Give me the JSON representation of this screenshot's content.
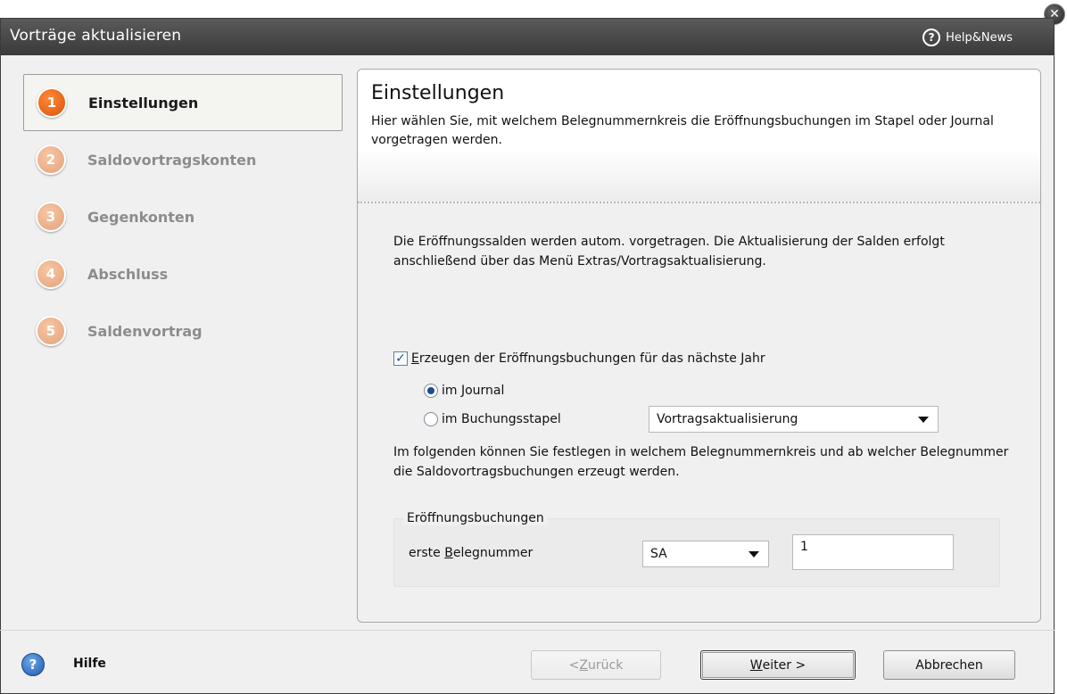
{
  "window": {
    "title": "Vorträge aktualisieren",
    "help_news": "Help&News"
  },
  "steps": [
    {
      "number": "1",
      "label": "Einstellungen",
      "active": true
    },
    {
      "number": "2",
      "label": "Saldovortragskonten",
      "active": false
    },
    {
      "number": "3",
      "label": "Gegenkonten",
      "active": false
    },
    {
      "number": "4",
      "label": "Abschluss",
      "active": false
    },
    {
      "number": "5",
      "label": "Saldenvortrag",
      "active": false
    }
  ],
  "header": {
    "title": "Einstellungen",
    "description": "Hier wählen Sie, mit welchem Belegnummernkreis die Eröffnungsbuchungen im Stapel oder Journal vorgetragen werden."
  },
  "body": {
    "info_text": "Die Eröffnungssalden werden autom. vorgetragen. Die Aktualisierung der Salden erfolgt anschließend über das Menü Extras/Vortragsaktualisierung.",
    "checkbox_label_u": "E",
    "checkbox_label_rest": "rzeugen der Eröffnungsbuchungen für das nächste Jahr",
    "radio_journal": "im Journal",
    "radio_stapel": "im Buchungsstapel",
    "stapel_select_value": "Vortragsaktualisierung",
    "belegnummer_text": "Im folgenden können Sie festlegen in welchem Belegnummernkreis und ab welcher Belegnummer die Saldovortragsbuchungen erzeugt werden."
  },
  "group": {
    "legend": "Eröffnungsbuchungen",
    "label_pre": "erste ",
    "label_u": "B",
    "label_post": "elegnummer",
    "kreis_value": "SA",
    "nummer_value": "1"
  },
  "footer": {
    "help_label": "Hilfe",
    "back_pre": "< ",
    "back_u": "Z",
    "back_post": "urück",
    "next_u": "W",
    "next_post": "eiter >",
    "cancel": "Abbrechen"
  },
  "colors": {
    "title_bar": "#4a4a4a",
    "step_active": "#e8651a",
    "step_inactive": "#f0b48c",
    "accent": "#1f5aa8"
  }
}
